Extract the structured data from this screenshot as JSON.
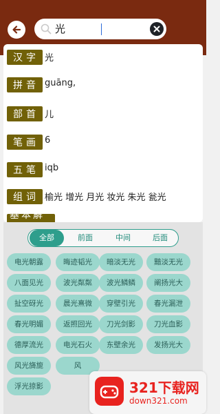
{
  "search": {
    "value": "光"
  },
  "entry": {
    "rows": [
      {
        "label": "汉字",
        "value": "光"
      },
      {
        "label": "拼音",
        "value": "guāng,"
      },
      {
        "label": "部首",
        "value": "儿"
      },
      {
        "label": "笔画",
        "value": "6"
      },
      {
        "label": "五笔",
        "value": "iqb"
      },
      {
        "label": "组词",
        "value": "榆光 增光 月光 妆光 朱光 瓮光"
      },
      {
        "label": "基本解释",
        "value": ""
      }
    ]
  },
  "filters": {
    "tabs": [
      "全部",
      "前面",
      "中间",
      "后面"
    ],
    "active": "全部"
  },
  "idioms": [
    "电光朝露",
    "晦迹韬光",
    "暗淡无光",
    "黯淡无光",
    "八面见光",
    "波光粼粼",
    "波光鳞鳞",
    "阐扬光大",
    "扯空砑光",
    "晨光熹微",
    "穿壁引光",
    "春光漏泄",
    "春光明媚",
    "返照回光",
    "刀光剑影",
    "刀光血影",
    "德厚流光",
    "电光石火",
    "东壁余光",
    "发扬光大",
    "风光旖旎",
    "风",
    "",
    "",
    "浮光掠影",
    "",
    "",
    ""
  ],
  "ad": {
    "title": "321下载网",
    "url": "down321.com"
  },
  "colors": {
    "topbar": "#7a2a10",
    "tag": "#716108",
    "chip": "#9bd7cd",
    "accent": "#2e9e8c"
  }
}
